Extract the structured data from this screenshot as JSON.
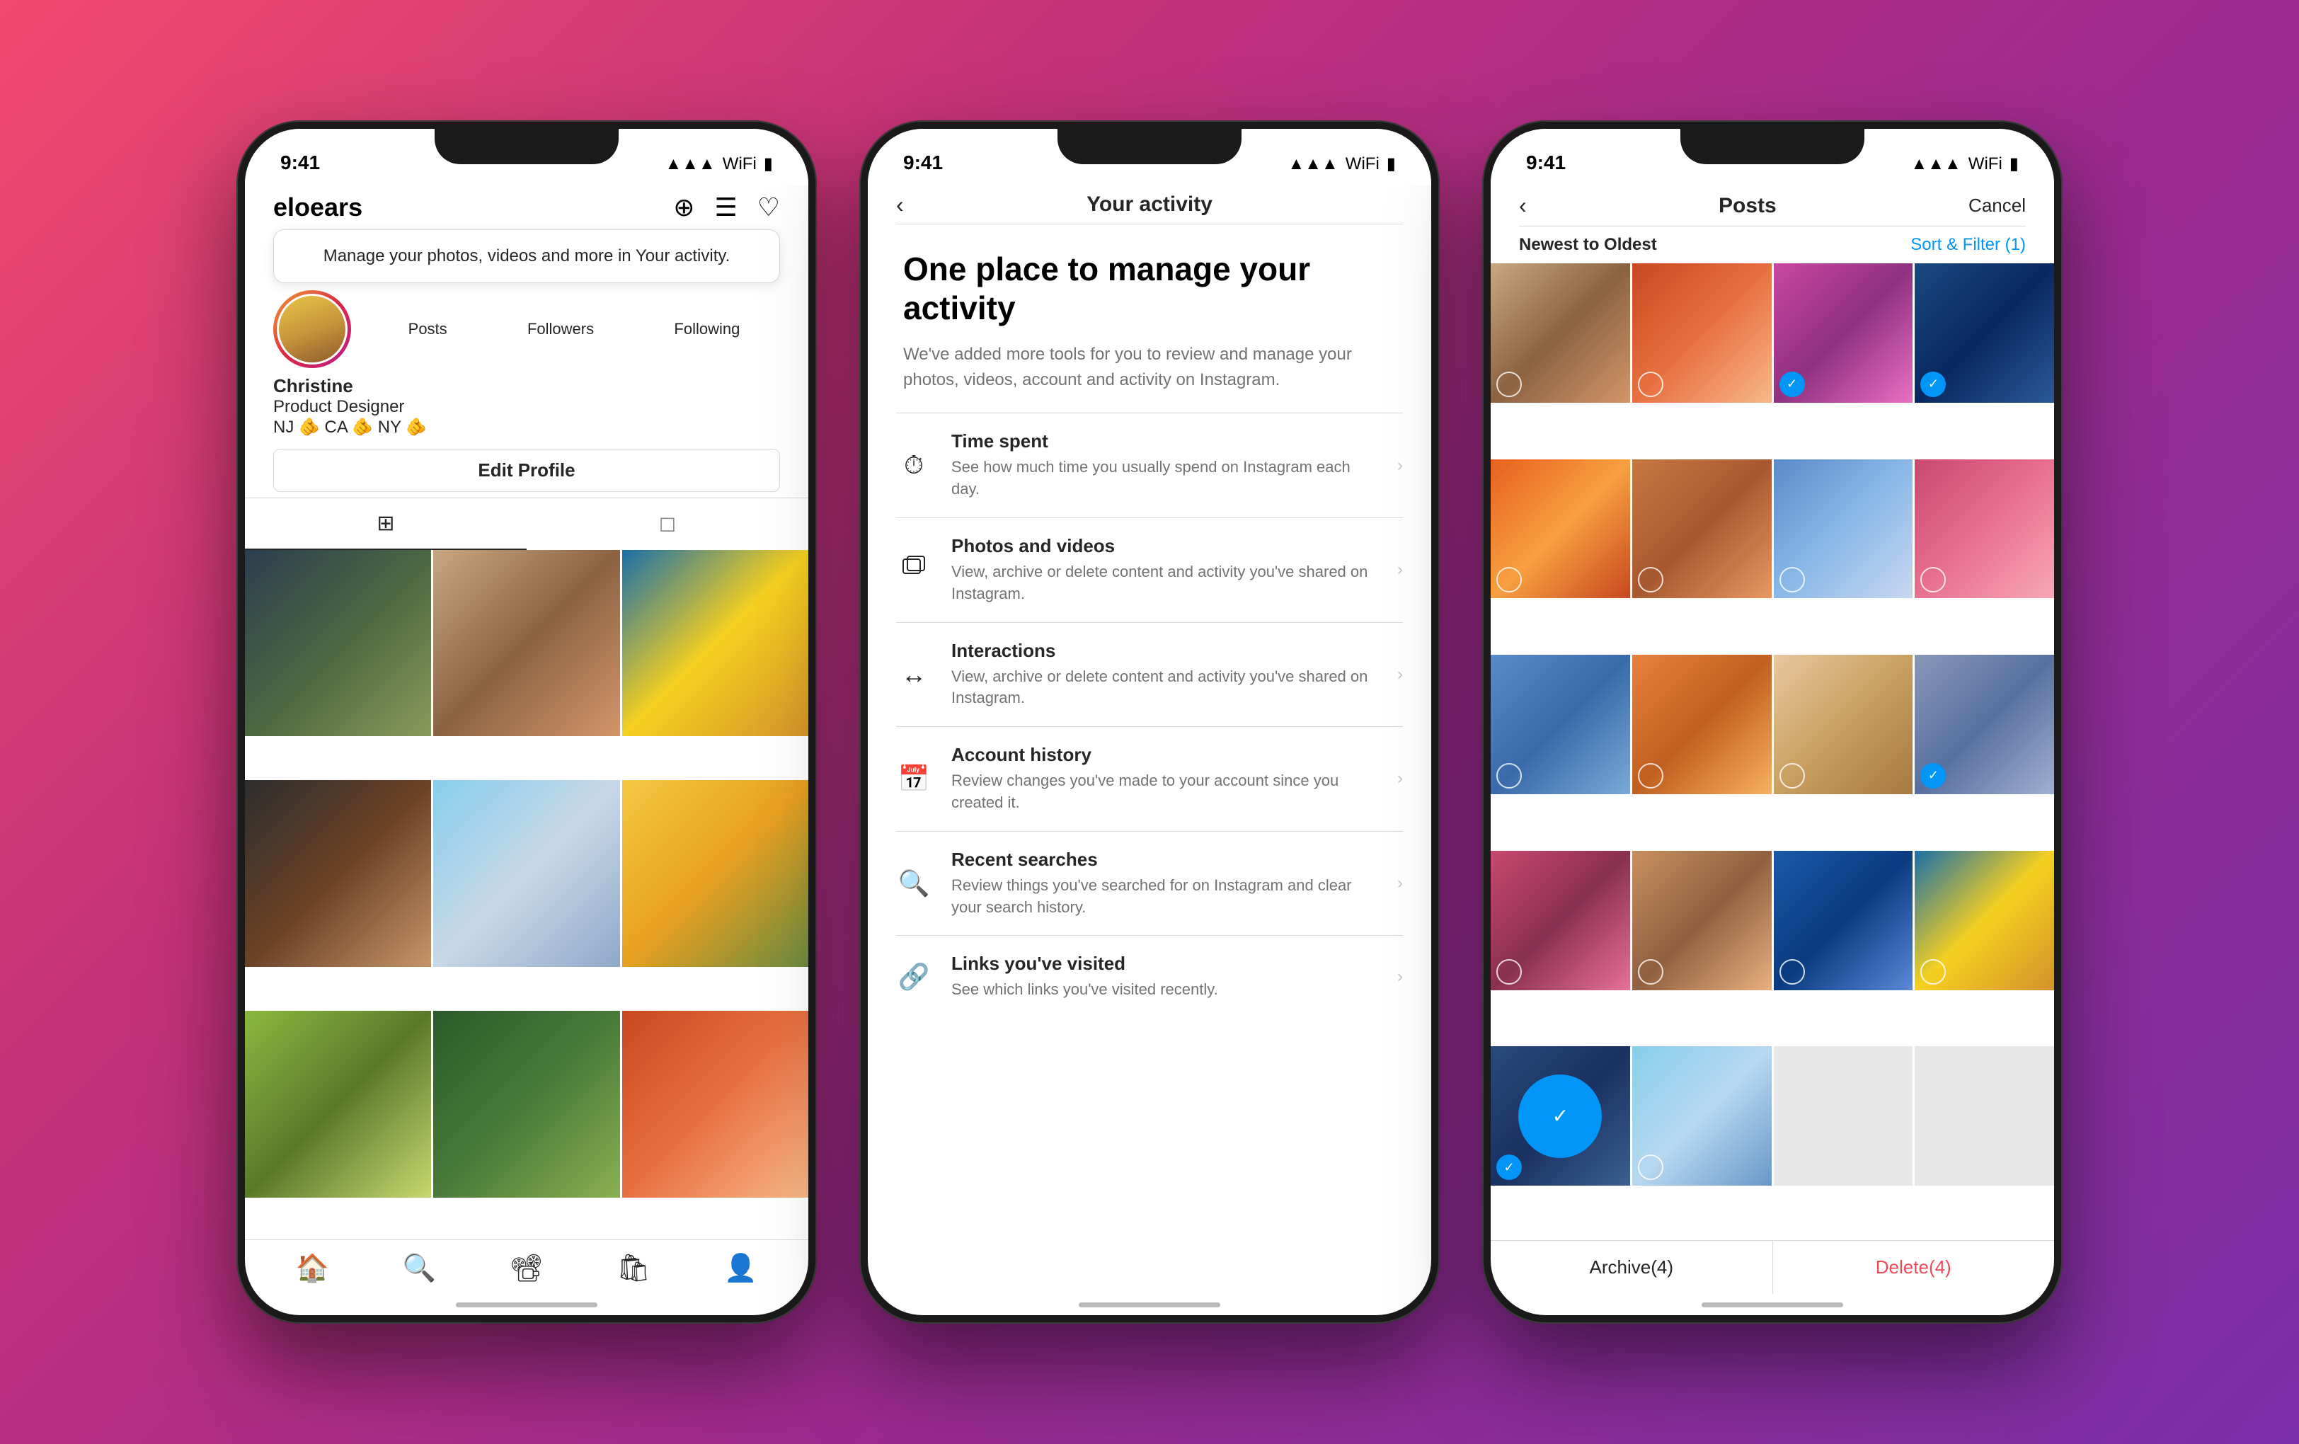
{
  "phone1": {
    "status_time": "9:41",
    "username": "eloears",
    "tooltip": "Manage your photos, videos and more in Your activity.",
    "stats": [
      {
        "label": "Posts",
        "value": ""
      },
      {
        "label": "Followers",
        "value": ""
      },
      {
        "label": "Following",
        "value": ""
      }
    ],
    "name": "Christine",
    "job": "Product Designer",
    "location": "NJ 🫵 CA 🫵 NY 🫵",
    "edit_profile": "Edit Profile",
    "bottom_nav": [
      "🏠",
      "🔍",
      "📽",
      "🛍",
      "👤"
    ]
  },
  "phone2": {
    "status_time": "9:41",
    "nav_title": "Your activity",
    "hero_title": "One place to manage your activity",
    "hero_desc": "We've added more tools for you to review and manage your photos, videos, account and activity on Instagram.",
    "menu_items": [
      {
        "icon": "⏱",
        "title": "Time spent",
        "desc": "See how much time you usually spend on Instagram each day."
      },
      {
        "icon": "📷",
        "title": "Photos and videos",
        "desc": "View, archive or delete content and activity you've shared on Instagram."
      },
      {
        "icon": "🔄",
        "title": "Interactions",
        "desc": "View, archive or delete content and activity you've shared on Instagram."
      },
      {
        "icon": "📅",
        "title": "Account history",
        "desc": "Review changes you've made to your account since you created it."
      },
      {
        "icon": "🔍",
        "title": "Recent searches",
        "desc": "Review things you've searched for on Instagram and clear your search history."
      },
      {
        "icon": "🔗",
        "title": "Links you've visited",
        "desc": "See which links you've visited recently."
      }
    ]
  },
  "phone3": {
    "status_time": "9:41",
    "nav_title": "Posts",
    "cancel_label": "Cancel",
    "sort_label": "Newest to Oldest",
    "sort_filter": "Sort & Filter (1)",
    "archive_btn": "Archive(4)",
    "delete_btn": "Delete(4)"
  }
}
